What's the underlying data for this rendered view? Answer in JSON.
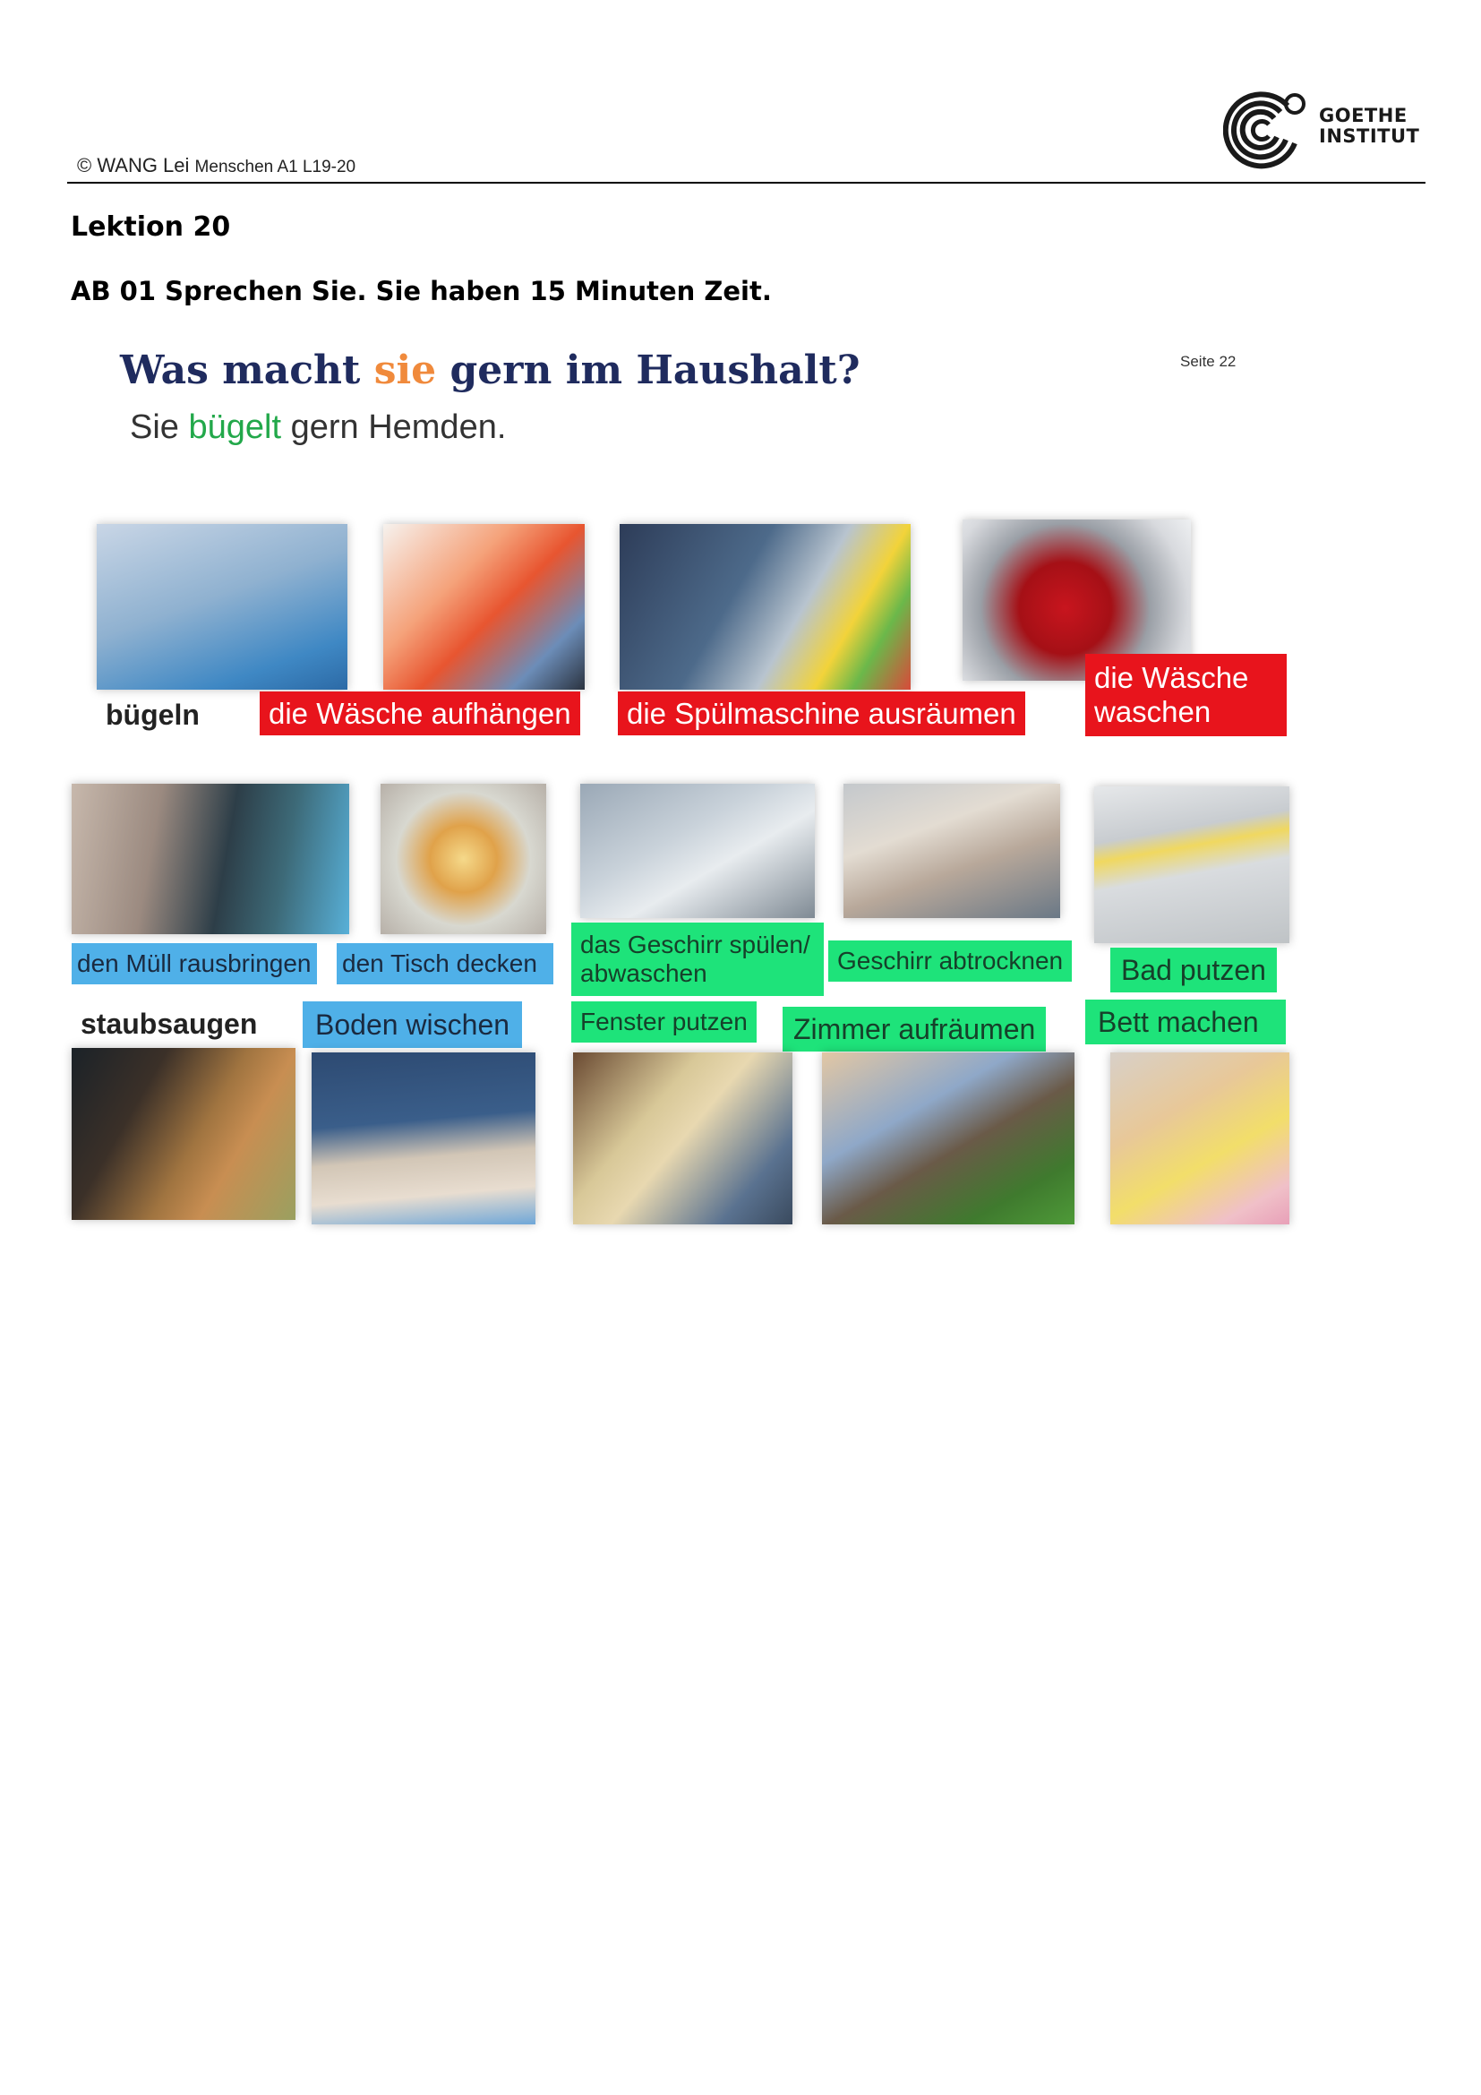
{
  "header": {
    "copyright": "© WANG Lei",
    "course": "Menschen A1 L19-20",
    "logo_line1": "GOETHE",
    "logo_line2": "INSTITUT"
  },
  "lesson_title": "Lektion 20",
  "task": "AB 01 Sprechen Sie. Sie haben 15  Minuten Zeit.",
  "worksheet": {
    "question_part1": "Was macht ",
    "question_highlight": "sie",
    "question_part2": " gern im Haushalt?",
    "answer_part1": "Sie ",
    "answer_highlight": "bügelt",
    "answer_part2": " gern Hemden.",
    "page_ref": "Seite 22",
    "labels": {
      "buegeln": "bügeln",
      "waesche_aufhaengen": "die Wäsche aufhängen",
      "spuelmaschine": "die Spülmaschine ausräumen",
      "waesche_waschen": "die Wäsche waschen",
      "muell": "den Müll rausbringen",
      "tisch": "den Tisch decken",
      "geschirr_spuelen": "das Geschirr spülen/ abwaschen",
      "abtrocknen": "Geschirr abtrocknen",
      "bad": "Bad putzen",
      "staubsaugen": "staubsaugen",
      "boden": "Boden wischen",
      "fenster": "Fenster putzen",
      "zimmer": "Zimmer aufräumen",
      "bett": "Bett machen"
    }
  },
  "colors": {
    "red_label": "#e8141c",
    "blue_label": "#4fb0e8",
    "green_label": "#1ee37a",
    "title_navy": "#1f2b5e",
    "highlight_orange": "#f08a3c",
    "highlight_green": "#22a84a"
  }
}
